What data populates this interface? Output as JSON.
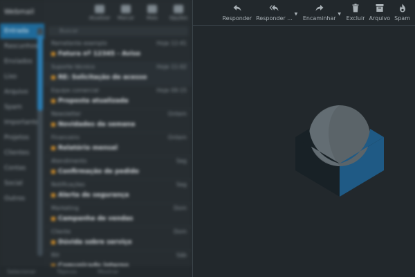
{
  "folders": {
    "header_label": "Webmail",
    "items": [
      {
        "label": "Entrada"
      },
      {
        "label": "Rascunhos"
      },
      {
        "label": "Enviados"
      },
      {
        "label": "Lixo"
      },
      {
        "label": "Arquivo"
      },
      {
        "label": "Spam"
      },
      {
        "label": "Importante"
      },
      {
        "label": "Projetos"
      },
      {
        "label": "Clientes"
      },
      {
        "label": "Contas"
      },
      {
        "label": "Social"
      },
      {
        "label": "Outros"
      }
    ]
  },
  "list": {
    "toolbar": [
      {
        "label": "Atualizar"
      },
      {
        "label": "Marcar"
      },
      {
        "label": "Mais"
      },
      {
        "label": "Opções"
      }
    ],
    "search_placeholder": "Buscar",
    "messages": [
      {
        "sender": "Remetente exemplo",
        "date": "Hoje 12:41",
        "subject": "Fatura nº 12345 - Aviso"
      },
      {
        "sender": "Suporte técnico",
        "date": "Hoje 11:02",
        "subject": "RE: Solicitação de acesso"
      },
      {
        "sender": "Equipe comercial",
        "date": "Hoje 09:15",
        "subject": "Proposta atualizada"
      },
      {
        "sender": "Newsletter",
        "date": "Ontem",
        "subject": "Novidades da semana"
      },
      {
        "sender": "Financeiro",
        "date": "Ontem",
        "subject": "Relatório mensal"
      },
      {
        "sender": "Atendimento",
        "date": "Seg",
        "subject": "Confirmação de pedido"
      },
      {
        "sender": "Notificações",
        "date": "Seg",
        "subject": "Alerta de segurança"
      },
      {
        "sender": "Marketing",
        "date": "Dom",
        "subject": "Campanha de vendas"
      },
      {
        "sender": "Cliente",
        "date": "Dom",
        "subject": "Dúvida sobre serviço"
      },
      {
        "sender": "RH",
        "date": "Sáb",
        "subject": "Comunicado interno"
      }
    ],
    "footer": [
      "Selecionar",
      "Tópicos",
      "Mostrar"
    ]
  },
  "toolbar": {
    "reply": {
      "label": "Responder",
      "icon": "reply-icon"
    },
    "reply_all": {
      "label": "Responder ...",
      "icon": "reply-all-icon"
    },
    "forward": {
      "label": "Encaminhar",
      "icon": "forward-icon"
    },
    "delete": {
      "label": "Excluir",
      "icon": "trash-icon"
    },
    "archive": {
      "label": "Arquivo",
      "icon": "archive-icon"
    },
    "spam": {
      "label": "Spam",
      "icon": "fire-icon"
    }
  },
  "colors": {
    "background": "#22282c",
    "accent": "#1f5a85",
    "toolbar_text": "#a9b1b6"
  }
}
